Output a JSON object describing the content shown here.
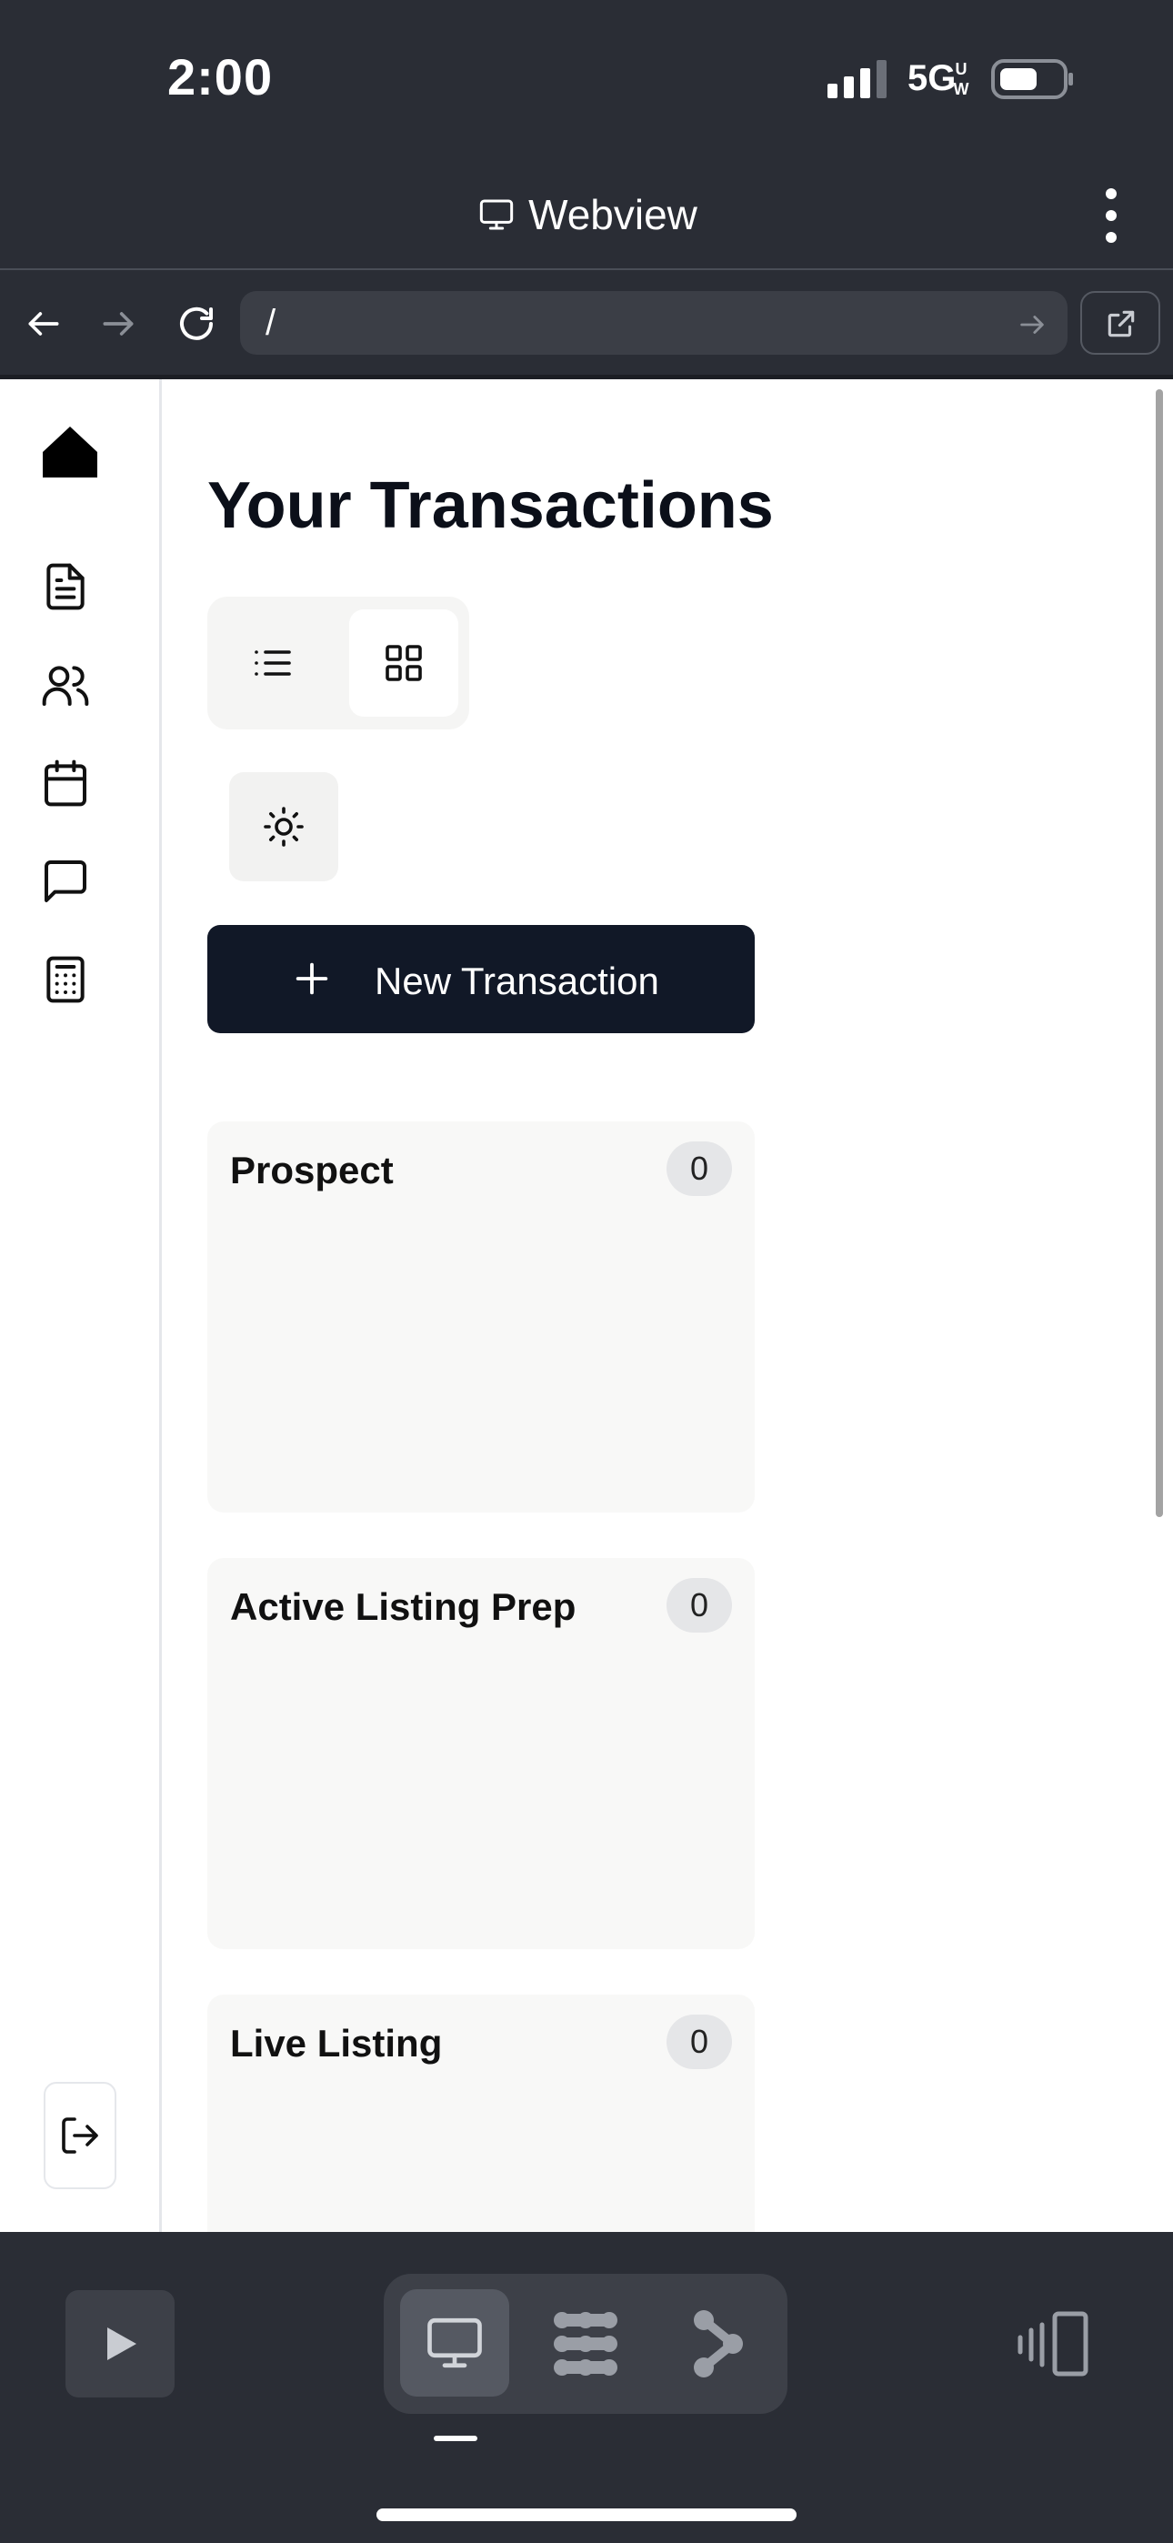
{
  "status_bar": {
    "time": "2:00",
    "network": "5G"
  },
  "webview_header": {
    "title": "Webview",
    "icon": "monitor-icon",
    "menu_icon": "more-vertical-icon"
  },
  "browser": {
    "url": "/",
    "back_icon": "arrow-left-icon",
    "forward_icon": "arrow-right-icon",
    "reload_icon": "reload-icon",
    "go_icon": "arrow-right-icon",
    "external_icon": "external-link-icon"
  },
  "sidebar": {
    "items": [
      {
        "name": "home",
        "icon": "home-icon"
      },
      {
        "name": "documents",
        "icon": "document-icon"
      },
      {
        "name": "contacts",
        "icon": "users-icon"
      },
      {
        "name": "calendar",
        "icon": "calendar-icon"
      },
      {
        "name": "messages",
        "icon": "message-icon"
      },
      {
        "name": "calculator",
        "icon": "calculator-icon"
      }
    ],
    "logout_icon": "logout-icon"
  },
  "main": {
    "title": "Your Transactions",
    "view_toggle": {
      "list_icon": "list-icon",
      "grid_icon": "grid-icon",
      "active": "grid"
    },
    "theme_icon": "sun-icon",
    "new_button": {
      "label": "New Transaction",
      "icon": "plus-icon"
    },
    "stages": [
      {
        "name": "Prospect",
        "count": "0"
      },
      {
        "name": "Active Listing Prep",
        "count": "0"
      },
      {
        "name": "Live Listing",
        "count": "0"
      }
    ]
  },
  "bottom_toolbar": {
    "play_icon": "play-icon",
    "modes": [
      {
        "name": "desktop",
        "icon": "monitor-icon",
        "active": true
      },
      {
        "name": "grid",
        "icon": "dots-grid-icon",
        "active": false
      },
      {
        "name": "flow",
        "icon": "flow-icon",
        "active": false
      }
    ],
    "rotate_icon": "rotate-device-icon"
  },
  "colors": {
    "chrome_bg": "#2a2d35",
    "primary_button": "#111827",
    "card_bg": "#f8f8f7",
    "badge_bg": "#e5e6e8"
  }
}
